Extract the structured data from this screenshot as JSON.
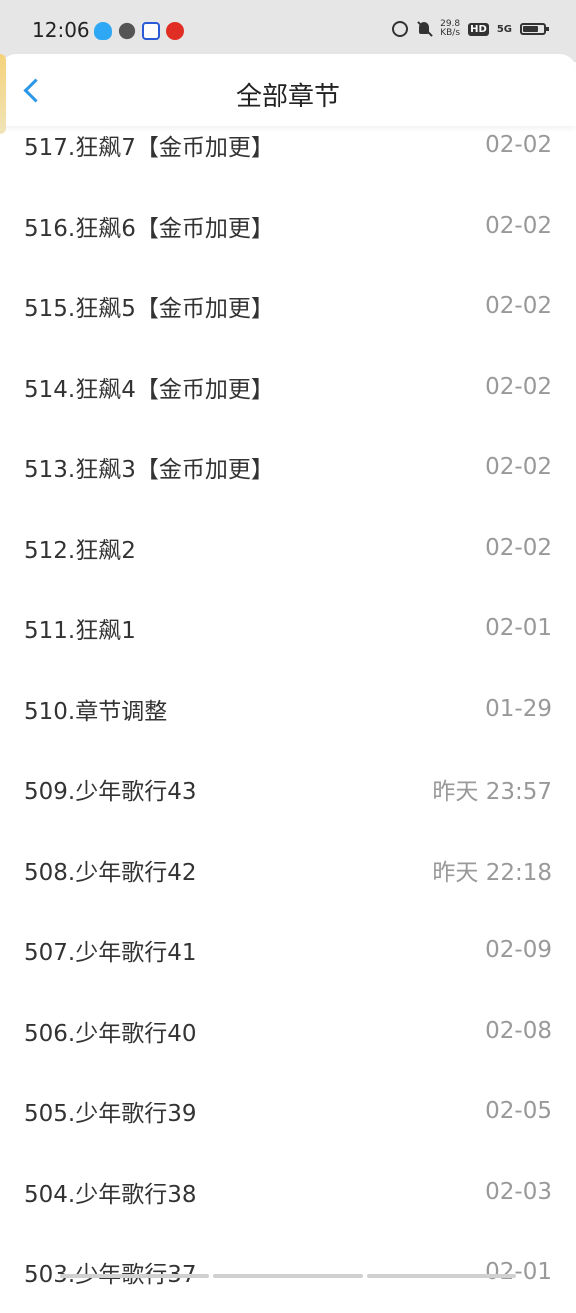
{
  "status": {
    "time": "12:06",
    "net_speed_value": "29.8",
    "net_speed_unit": "KB/s",
    "hd": "HD",
    "network": "5G",
    "battery_level": 0.7
  },
  "header": {
    "title": "全部章节"
  },
  "chapters": [
    {
      "title": "517.狂飙7【金币加更】",
      "date": "02-02"
    },
    {
      "title": "516.狂飙6【金币加更】",
      "date": "02-02"
    },
    {
      "title": "515.狂飙5【金币加更】",
      "date": "02-02"
    },
    {
      "title": "514.狂飙4【金币加更】",
      "date": "02-02"
    },
    {
      "title": "513.狂飙3【金币加更】",
      "date": "02-02"
    },
    {
      "title": "512.狂飙2",
      "date": "02-02"
    },
    {
      "title": "511.狂飙1",
      "date": "02-01"
    },
    {
      "title": "510.章节调整",
      "date": "01-29"
    },
    {
      "title": "509.少年歌行43",
      "date": "昨天 23:57"
    },
    {
      "title": "508.少年歌行42",
      "date": "昨天 22:18"
    },
    {
      "title": "507.少年歌行41",
      "date": "02-09"
    },
    {
      "title": "506.少年歌行40",
      "date": "02-08"
    },
    {
      "title": "505.少年歌行39",
      "date": "02-05"
    },
    {
      "title": "504.少年歌行38",
      "date": "02-03"
    },
    {
      "title": "503.少年歌行37",
      "date": "02-01"
    }
  ]
}
